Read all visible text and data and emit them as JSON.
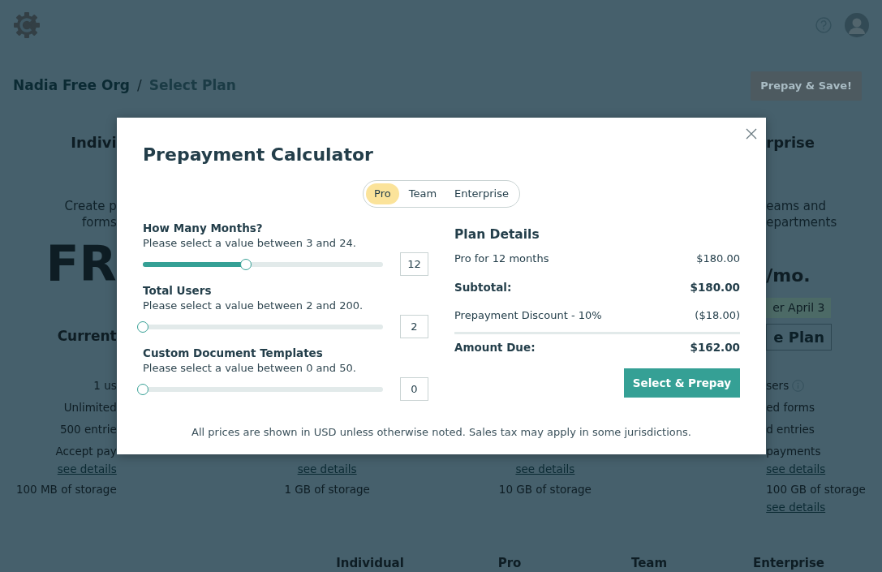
{
  "header": {
    "breadcrumb": [
      {
        "text": "Nadia Free Org",
        "current": false
      },
      {
        "text": "Select Plan",
        "current": true
      }
    ],
    "separator": "/",
    "prepay_button": "Prepay & Save!"
  },
  "plans": [
    {
      "heading": "Indivi",
      "description": [
        "Create p",
        "forms"
      ],
      "price": "FR",
      "action": {
        "kind": "label",
        "text": "Current"
      },
      "features": [
        {
          "text": "1 us",
          "info": false
        },
        {
          "text": "Unlimited",
          "info": false
        },
        {
          "text": "500 entrie",
          "info": false
        },
        {
          "text": "Accept pay",
          "info": false
        }
      ],
      "payments_link": "see details",
      "storage": "100 MB of storage"
    },
    {
      "payments_link": "see details",
      "storage": "1 GB of storage"
    },
    {
      "payments_link": "see details",
      "storage": "10 GB of storage"
    },
    {
      "heading": "rprise",
      "description": [
        "eams and",
        "epartments"
      ],
      "price_unit": "/**mo.**",
      "badge": "er April 3",
      "action": {
        "kind": "button",
        "text": "e Plan"
      },
      "features": [
        {
          "text": "sers",
          "info": true
        },
        {
          "text": "ed forms",
          "info": false
        },
        {
          "text": "d entries",
          "info": false
        },
        {
          "text": "payments",
          "info": false
        }
      ],
      "payments_link": "see details",
      "storage": "100 GB of storage",
      "storage_link": "see details"
    }
  ],
  "comparison_header": [
    "Individual",
    "Pro",
    "Team",
    "Enterprise"
  ],
  "modal": {
    "title": "Prepayment Calculator",
    "plan_tabs": [
      {
        "label": "Pro",
        "selected": true
      },
      {
        "label": "Team",
        "selected": false
      },
      {
        "label": "Enterprise",
        "selected": false
      }
    ],
    "sliders": [
      {
        "label": "How Many Months?",
        "hint": "Please select a value between 3 and 24.",
        "level": 0.43,
        "value": "12"
      },
      {
        "label": "Total Users",
        "hint": "Please select a value between 2 and 200.",
        "level": 0,
        "value": "2"
      },
      {
        "label": "Custom Document Templates",
        "hint": "Please select a value between 0 and 50.",
        "level": 0,
        "value": "0"
      }
    ],
    "plan_details": {
      "title": "Plan Details",
      "lines": [
        {
          "label": "Pro for 12 months",
          "amount": "$180.00",
          "kind": "item",
          "rule_before": false
        },
        {
          "label": "Subtotal:",
          "amount": "$180.00",
          "kind": "total",
          "rule_before": false
        },
        {
          "label": "Prepayment Discount - 10%",
          "amount": "($18.00)",
          "kind": "item",
          "rule_before": false
        },
        {
          "label": "Amount Due:",
          "amount": "$162.00",
          "kind": "total",
          "rule_before": true
        }
      ]
    },
    "action_button": "Select & Prepay",
    "note": "All prices are shown in USD unless otherwise noted. Sales tax may apply in some jurisdictions."
  }
}
